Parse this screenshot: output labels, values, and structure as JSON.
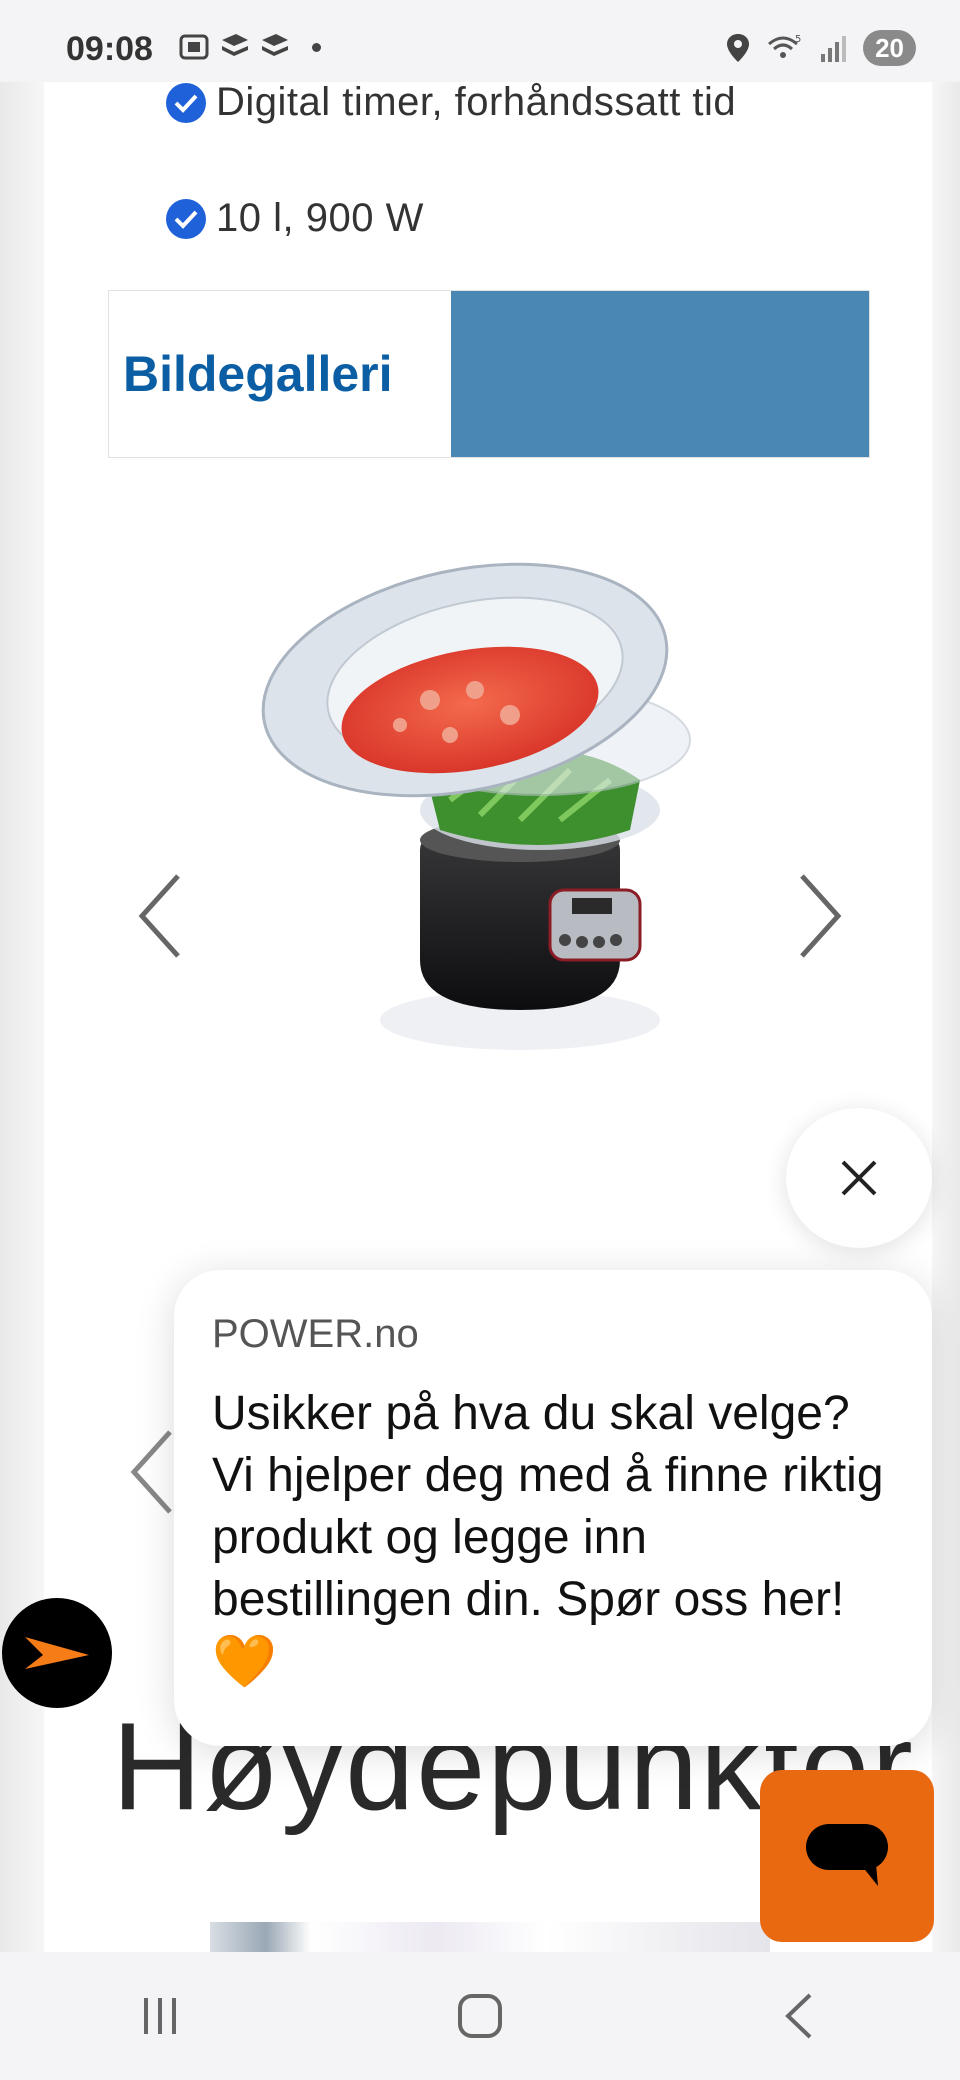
{
  "status_bar": {
    "time": "09:08",
    "battery": "20",
    "left_icons": [
      "screenshot-icon",
      "stack-icon",
      "stack-icon",
      "dot-icon"
    ],
    "right_icons": [
      "location-icon",
      "wifi-5g-icon",
      "signal-icon"
    ]
  },
  "features": [
    {
      "label": "Digital timer, forhåndssatt tid"
    },
    {
      "label": "10 l, 900 W"
    }
  ],
  "gallery": {
    "title": "Bildegalleri",
    "band_color": "#4a87b5",
    "title_color": "#0b5ea3"
  },
  "product": {
    "icon": "food-steamer-image"
  },
  "chat": {
    "brand": "POWER.no",
    "message": "Usikker på hva du skal velge? Vi hjelper deg med å finne riktig produkt og legge inn bestillingen din. Spør oss her!",
    "emoji": "🧡",
    "launcher_color": "#e8690f"
  },
  "section": {
    "heading": "Høydepunkter"
  },
  "nav": {
    "buttons": [
      "recent-apps-icon",
      "home-icon",
      "back-icon"
    ]
  }
}
